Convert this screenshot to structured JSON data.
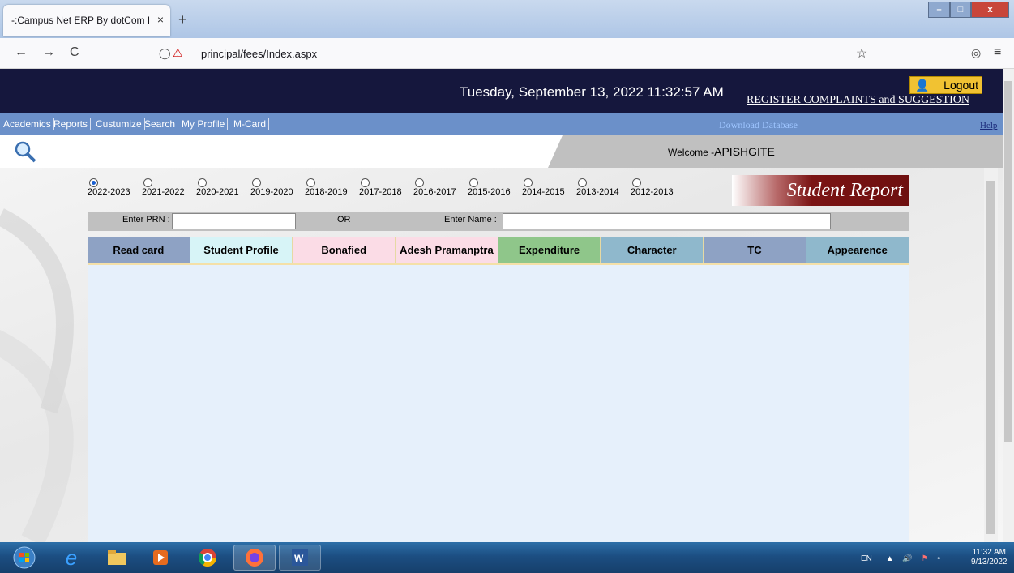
{
  "browser": {
    "tab_title": "-:Campus Net ERP By dotCom Infot",
    "tab_close": "×",
    "new_tab": "+",
    "url": "principal/fees/Index.aspx",
    "win_min": "–",
    "win_max": "□",
    "win_close": "x",
    "back_glyph": "←",
    "forward_glyph": "→",
    "reload_glyph": "C",
    "shield_glyph": "◯",
    "star_glyph": "☆",
    "pocket_glyph": "◎",
    "menu_glyph": "≡"
  },
  "header": {
    "datetime": "Tuesday, September 13, 2022 11:32:57 AM",
    "logout": "Logout",
    "complaints": "REGISTER COMPLAINTS and SUGGESTION"
  },
  "menu": {
    "items": [
      "Academics",
      "Reports",
      "Custumize",
      "Search",
      "My Profile",
      "M-Card"
    ],
    "download": "Download Database",
    "help": "Help"
  },
  "welcome": {
    "prefix": "Welcome -",
    "user": "APISHGITE"
  },
  "years": {
    "options": [
      "2022-2023",
      "2021-2022",
      "2020-2021",
      "2019-2020",
      "2018-2019",
      "2017-2018",
      "2016-2017",
      "2015-2016",
      "2014-2015",
      "2013-2014",
      "2012-2013"
    ],
    "selected": "2022-2023"
  },
  "report_title": "Student Report",
  "search": {
    "prn_label": "Enter PRN :",
    "or_label": "OR",
    "name_label": "Enter Name :",
    "prn_value": "",
    "name_value": ""
  },
  "tabs": [
    {
      "label": "Read card",
      "color": "#8ea2c4"
    },
    {
      "label": "Student Profile",
      "color": "#d7f4f7"
    },
    {
      "label": "Bonafied",
      "color": "#fbdce6"
    },
    {
      "label": "Adesh Pramanptra",
      "color": "#fbdce6"
    },
    {
      "label": "Expenditure",
      "color": "#8fc68a"
    },
    {
      "label": "Character",
      "color": "#8fb8cc"
    },
    {
      "label": "TC",
      "color": "#8ea2c4"
    },
    {
      "label": "Appearence",
      "color": "#8fb8cc"
    }
  ],
  "taskbar": {
    "lang": "EN",
    "time": "11:32 AM",
    "date": "9/13/2022"
  },
  "colors": {
    "header_bg": "#15173d",
    "menu_bg": "#6b90c9",
    "content_bg": "#e6f0fb",
    "report_banner": "#7b1414"
  }
}
